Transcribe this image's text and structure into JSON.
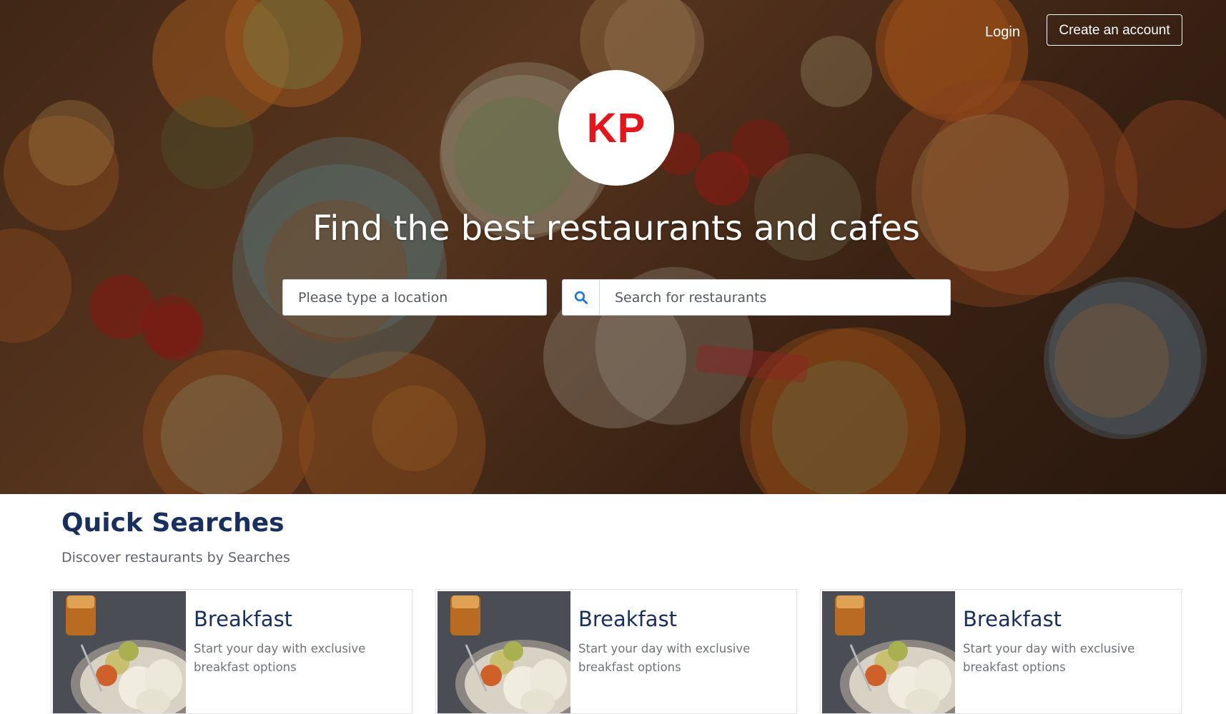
{
  "header": {
    "login_label": "Login",
    "create_account_label": "Create an account"
  },
  "hero": {
    "logo_text": "KP",
    "headline": "Find the best restaurants and cafes",
    "location_placeholder": "Please type a location",
    "search_placeholder": "Search for restaurants",
    "colors": {
      "logo_red": "#e8141b",
      "search_icon_blue": "#1a73e8"
    }
  },
  "quick_searches": {
    "title": "Quick Searches",
    "subtitle": "Discover restaurants by Searches",
    "title_color": "#192f60",
    "cards": [
      {
        "title": "Breakfast",
        "description": "Start your day with exclusive breakfast options",
        "image": "breakfast-photo"
      },
      {
        "title": "Breakfast",
        "description": "Start your day with exclusive breakfast options",
        "image": "breakfast-photo"
      },
      {
        "title": "Breakfast",
        "description": "Start your day with exclusive breakfast options",
        "image": "breakfast-photo"
      }
    ]
  },
  "icons": {
    "search": "search-icon"
  }
}
